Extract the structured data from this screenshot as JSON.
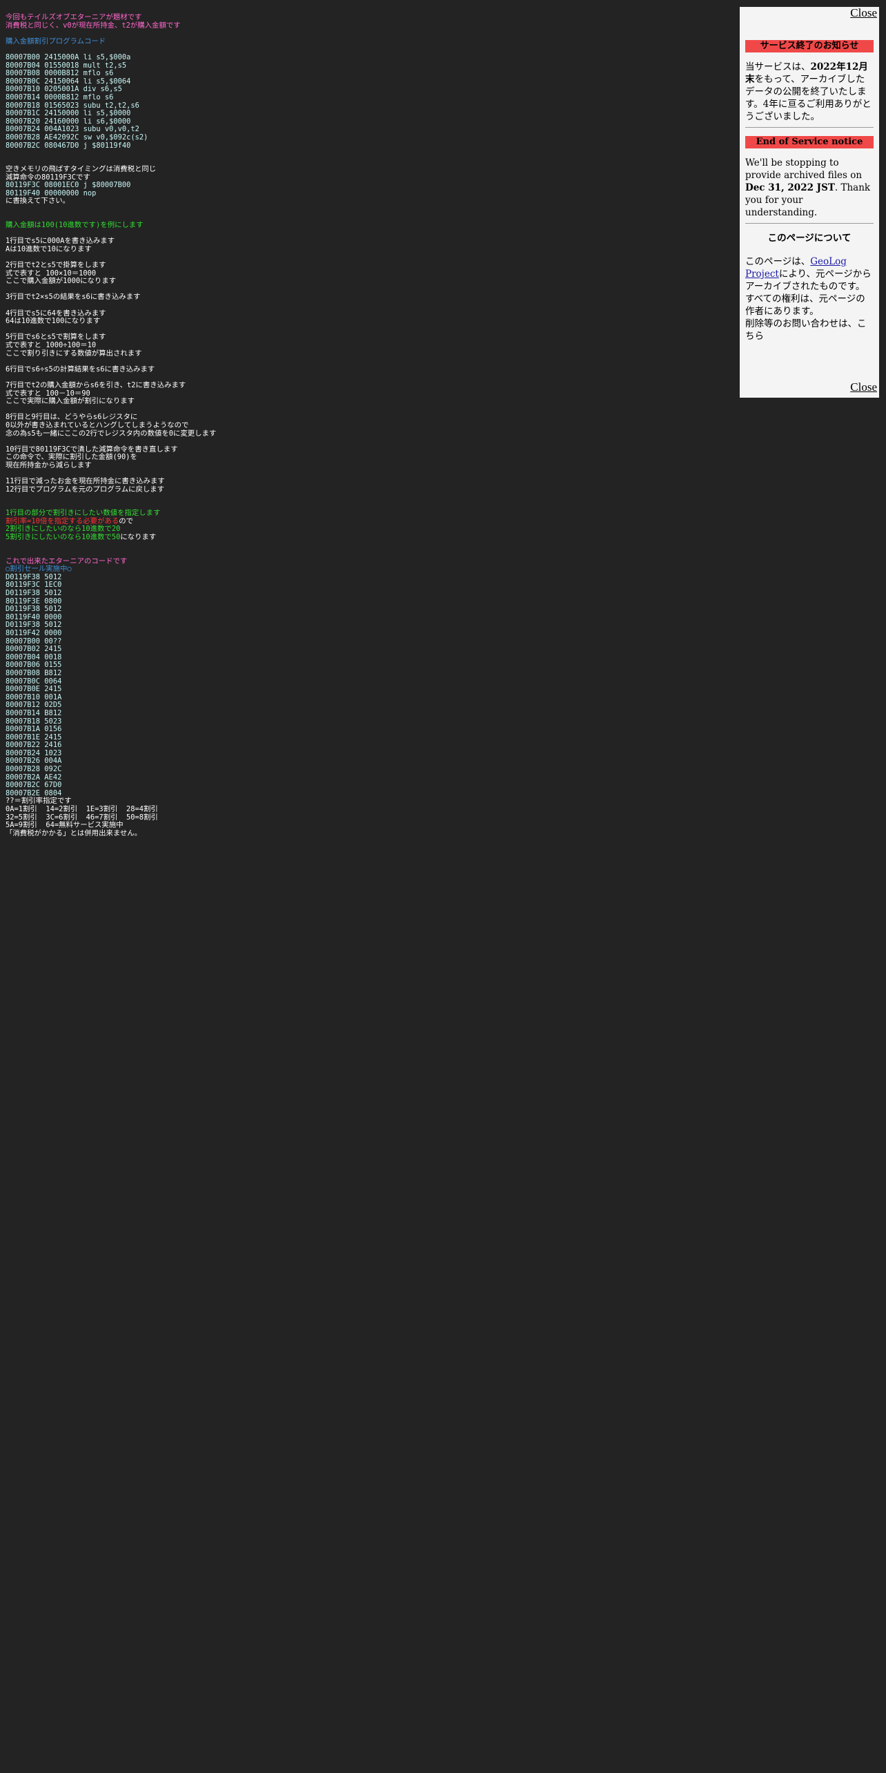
{
  "intro": {
    "line1": "今回もテイルズオブエターニアが題材です",
    "line2": "消費税と同じく、v0が現在所持金、t2が購入金額です"
  },
  "program": {
    "title": "購入金額割引プログラムコード",
    "lines": [
      "80007B00 2415000A li s5,$000a",
      "80007B04 01550018 mult t2,s5",
      "80007B08 0000B812 mflo s6",
      "80007B0C 24150064 li s5,$0064",
      "80007B10 0205001A div s6,s5",
      "80007B14 0000B812 mflo s6",
      "80007B18 01565023 subu t2,t2,s6",
      "80007B1C 24150000 li s5,$0000",
      "80007B20 24160000 li s6,$0000",
      "80007B24 004A1023 subu v0,v0,t2",
      "80007B28 AE42092C sw v0,$092c(s2)",
      "80007B2C 080467D0 j $80119f40"
    ]
  },
  "hook": {
    "line1": "空きメモリの飛ばすタイミングは消費税と同じ",
    "line2": "減算命令の80119F3Cです",
    "code1": "80119F3C 08001EC0 j $80007B00",
    "code2": "80119F40 00000000 nop",
    "line3": "に書換えて下さい。"
  },
  "explain": {
    "title": "購入金額は100(10進数です)を例にします",
    "blocks": [
      [
        "1行目でs5に000Aを書き込みます",
        "Aは10進数で10になります"
      ],
      [
        "2行目でt2とs5で掛算をします",
        "式で表すと 100×10＝1000",
        "ここで購入金額が1000になります"
      ],
      [
        "3行目でt2×s5の結果をs6に書き込みます"
      ],
      [
        "4行目でs5に64を書き込みます",
        "64は10進数で100になります"
      ],
      [
        "5行目でs6とs5で割算をします",
        "式で表すと 1000÷100＝10",
        "ここで割り引きにする数値が算出されます"
      ],
      [
        "6行目でs6÷s5の計算結果をs6に書き込みます"
      ],
      [
        "7行目でt2の購入金額からs6を引き、t2に書き込みます",
        "式で表すと 100－10＝90",
        "ここで実際に購入金額が割引になります"
      ],
      [
        "8行目と9行目は、どうやらs6レジスタに",
        "0以外が書き込まれているとハングしてしまうようなので",
        "念の為s5も一緒にここの2行でレジスタ内の数値を0に変更します"
      ],
      [
        "10行目で80119F3Cで潰した減算命令を書き直します",
        "この命令で、実際に割引した金額(90)を",
        "現在所持金から減らします"
      ],
      [
        "11行目で減ったお金を現在所持金に書き込みます",
        "12行目でプログラムを元のプログラムに戻します"
      ]
    ]
  },
  "discount": {
    "line1": "1行目の部分で割引きにしたい数値を指定します",
    "line2_red": "割引率=10倍を指定する必要がある",
    "line2_white": "ので",
    "line3": "2割引きにしたいのなら10進数で20",
    "line4_green": "5割引きにしたいのなら10進数で50",
    "line4_white": "になります"
  },
  "final": {
    "title": "これで出来たエターニアのコードです",
    "subtitle": "○割引セール実施中○",
    "codes": [
      "D0119F38 5012",
      "80119F3C 1EC0",
      "D0119F38 5012",
      "80119F3E 0800",
      "D0119F38 5012",
      "80119F40 0000",
      "D0119F38 5012",
      "80119F42 0000",
      "80007B00 00??",
      "80007B02 2415",
      "80007B04 0018",
      "80007B06 0155",
      "80007B08 B812",
      "80007B0C 0064",
      "80007B0E 2415",
      "80007B10 001A",
      "80007B12 02D5",
      "80007B14 B812",
      "80007B18 5023",
      "80007B1A 0156",
      "80007B1E 2415",
      "80007B22 2416",
      "80007B24 1023",
      "80007B26 004A",
      "80007B28 092C",
      "80007B2A AE42",
      "80007B2C 67D0",
      "80007B2E 0804"
    ],
    "note1": "??＝割引率指定です",
    "rate_lines": [
      "0A=1割引  14=2割引  1E=3割引  28=4割引",
      "32=5割引  3C=6割引  46=7割引  50=8割引",
      "5A=9割引  64=無料サービス実施中"
    ],
    "note2": "「消費税がかかる」とは併用出来ません。"
  },
  "notice": {
    "close_label": "Close",
    "jp_heading": "サービス終了のお知らせ",
    "jp_text_1": "当サービスは、",
    "jp_text_bold": "2022年12月末",
    "jp_text_2": "をもって、アーカイブしたデータの公開を終了いたします。4年に亘るご利用ありがとうございました。",
    "en_heading": "End of Service notice",
    "en_text_1": "We'll be stopping to provide archived files on ",
    "en_text_bold": "Dec 31, 2022 JST",
    "en_text_2": ". Thank you for your understanding.",
    "about_title": "このページについて",
    "about_1": "このページは、",
    "about_link": "GeoLog Project",
    "about_2": "により、元ページからアーカイブされたものです。",
    "about_3": "すべての権利は、元ページの作者にあります。",
    "about_4": "削除等のお問い合わせは、こちら"
  },
  "colors": {
    "background": "#232323",
    "pink": "#ff66cc",
    "cyan": "#9ef0f0",
    "blue": "#3f8fd8",
    "green": "#33dd33",
    "red": "#ff3333",
    "notice_bg": "#f4f4f4",
    "notice_heading_bg": "#f04848"
  }
}
